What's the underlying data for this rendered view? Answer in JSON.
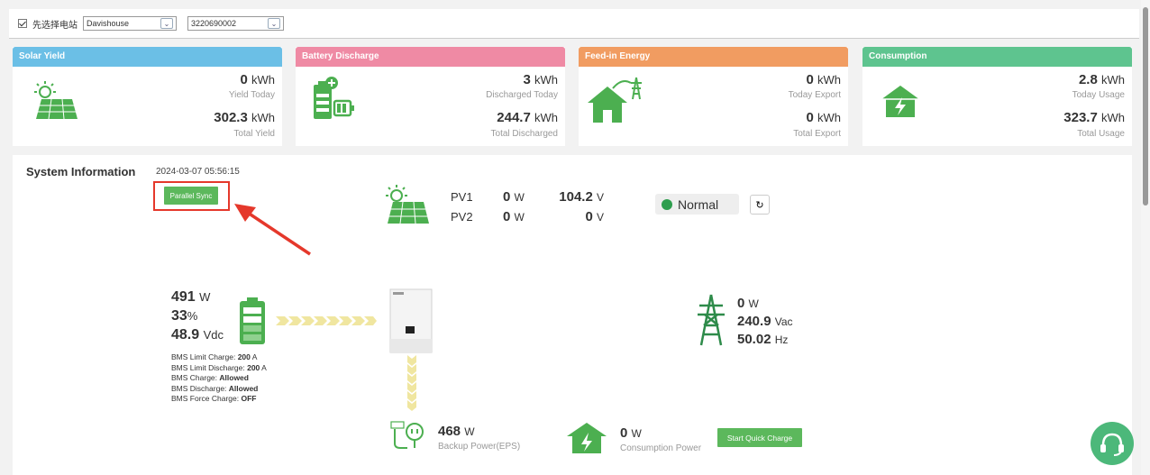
{
  "topbar": {
    "checkbox_label": "先选择电站",
    "station_select": "Davishouse",
    "device_select": "3220690002"
  },
  "cards": [
    {
      "title": "Solar Yield",
      "color": "#6bbfe6",
      "v1": "0",
      "u1": "kWh",
      "l1": "Yield Today",
      "v2": "302.3",
      "u2": "kWh",
      "l2": "Total Yield",
      "icon": "solar-panel-icon"
    },
    {
      "title": "Battery Discharge",
      "color": "#ef8aa4",
      "v1": "3",
      "u1": "kWh",
      "l1": "Discharged Today",
      "v2": "244.7",
      "u2": "kWh",
      "l2": "Total Discharged",
      "icon": "battery-icon"
    },
    {
      "title": "Feed-in Energy",
      "color": "#f19c61",
      "v1": "0",
      "u1": "kWh",
      "l1": "Today Export",
      "v2": "0",
      "u2": "kWh",
      "l2": "Total Export",
      "icon": "house-grid-icon"
    },
    {
      "title": "Consumption",
      "color": "#5ec48f",
      "v1": "2.8",
      "u1": "kWh",
      "l1": "Today Usage",
      "v2": "323.7",
      "u2": "kWh",
      "l2": "Total Usage",
      "icon": "house-power-icon"
    }
  ],
  "system": {
    "title": "System Information",
    "timestamp": "2024-03-07 05:56:15",
    "parallel_sync": "Parallel Sync",
    "status": "Normal",
    "pv": [
      {
        "name": "PV1",
        "w": "0",
        "w_unit": "W",
        "v": "104.2",
        "v_unit": "V"
      },
      {
        "name": "PV2",
        "w": "0",
        "w_unit": "W",
        "v": "0",
        "v_unit": "V"
      }
    ],
    "battery": {
      "power": "491",
      "power_unit": "W",
      "soc": "33",
      "soc_unit": "%",
      "voltage": "48.9",
      "voltage_unit": "Vdc"
    },
    "bms": [
      {
        "label": "BMS Limit Charge: ",
        "value": "200",
        "unit": " A"
      },
      {
        "label": "BMS Limit Discharge: ",
        "value": "200",
        "unit": " A"
      },
      {
        "label": "BMS Charge: ",
        "value": "Allowed",
        "unit": ""
      },
      {
        "label": "BMS Discharge: ",
        "value": "Allowed",
        "unit": ""
      },
      {
        "label": "BMS Force Charge: ",
        "value": "OFF",
        "unit": ""
      }
    ],
    "grid": {
      "power": "0",
      "power_unit": "W",
      "voltage": "240.9",
      "voltage_unit": "Vac",
      "freq": "50.02",
      "freq_unit": "Hz"
    },
    "eps": {
      "power": "468",
      "unit": "W",
      "label": "Backup Power(EPS)"
    },
    "consumption": {
      "power": "0",
      "unit": "W",
      "label": "Consumption Power"
    },
    "quick_charge": "Start Quick Charge"
  },
  "colors": {
    "green": "#2e9e4e",
    "accent_red": "#e5382b"
  }
}
